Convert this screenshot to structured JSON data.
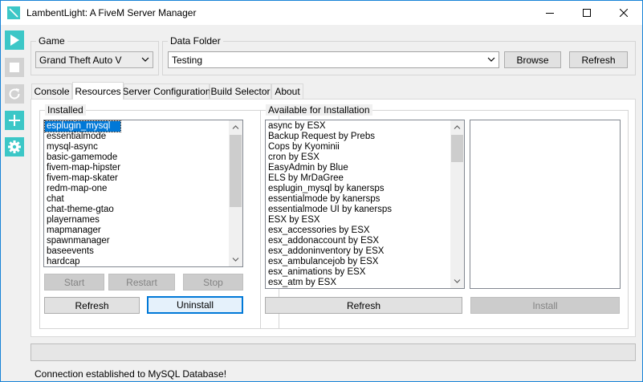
{
  "window": {
    "title": "LambentLight: A FiveM Server Manager"
  },
  "toolbar": {
    "start": "play-icon",
    "stop": "stop-icon",
    "restart": "refresh-icon",
    "create": "plus-icon",
    "settings": "gear-icon"
  },
  "game_group": {
    "label": "Game",
    "selected": "Grand Theft Auto V"
  },
  "data_folder_group": {
    "label": "Data Folder",
    "selected": "Testing",
    "browse_label": "Browse",
    "refresh_label": "Refresh"
  },
  "tabs": [
    {
      "label": "Console",
      "active": false
    },
    {
      "label": "Resources",
      "active": true
    },
    {
      "label": "Server Configuration",
      "active": false
    },
    {
      "label": "Build Selector",
      "active": false
    },
    {
      "label": "About",
      "active": false
    }
  ],
  "installed": {
    "label": "Installed",
    "items": [
      "esplugin_mysql",
      "essentialmode",
      "mysql-async",
      "basic-gamemode",
      "fivem-map-hipster",
      "fivem-map-skater",
      "redm-map-one",
      "chat",
      "chat-theme-gtao",
      "playernames",
      "mapmanager",
      "spawnmanager",
      "baseevents",
      "hardcap"
    ],
    "selected_index": 0,
    "start_label": "Start",
    "restart_label": "Restart",
    "stop_label": "Stop",
    "refresh_label": "Refresh",
    "uninstall_label": "Uninstall"
  },
  "available": {
    "label": "Available for Installation",
    "items": [
      "async by ESX",
      "Backup Request by Prebs",
      "Cops by Kyominii",
      "cron by ESX",
      "EasyAdmin by Blue",
      "ELS by MrDaGree",
      "esplugin_mysql by kanersps",
      "essentialmode by kanersps",
      "essentialmode UI by kanersps",
      "ESX by ESX",
      "esx_accessories by ESX",
      "esx_addonaccount by ESX",
      "esx_addoninventory by ESX",
      "esx_ambulancejob by ESX",
      "esx_animations by ESX",
      "esx_atm by ESX"
    ],
    "refresh_label": "Refresh",
    "install_label": "Install"
  },
  "status": {
    "progress": 0,
    "message": "Connection established to MySQL Database!"
  },
  "colors": {
    "accent": "#3cc7c7",
    "selection": "#0078d7",
    "focus_border": "#0078d7"
  }
}
